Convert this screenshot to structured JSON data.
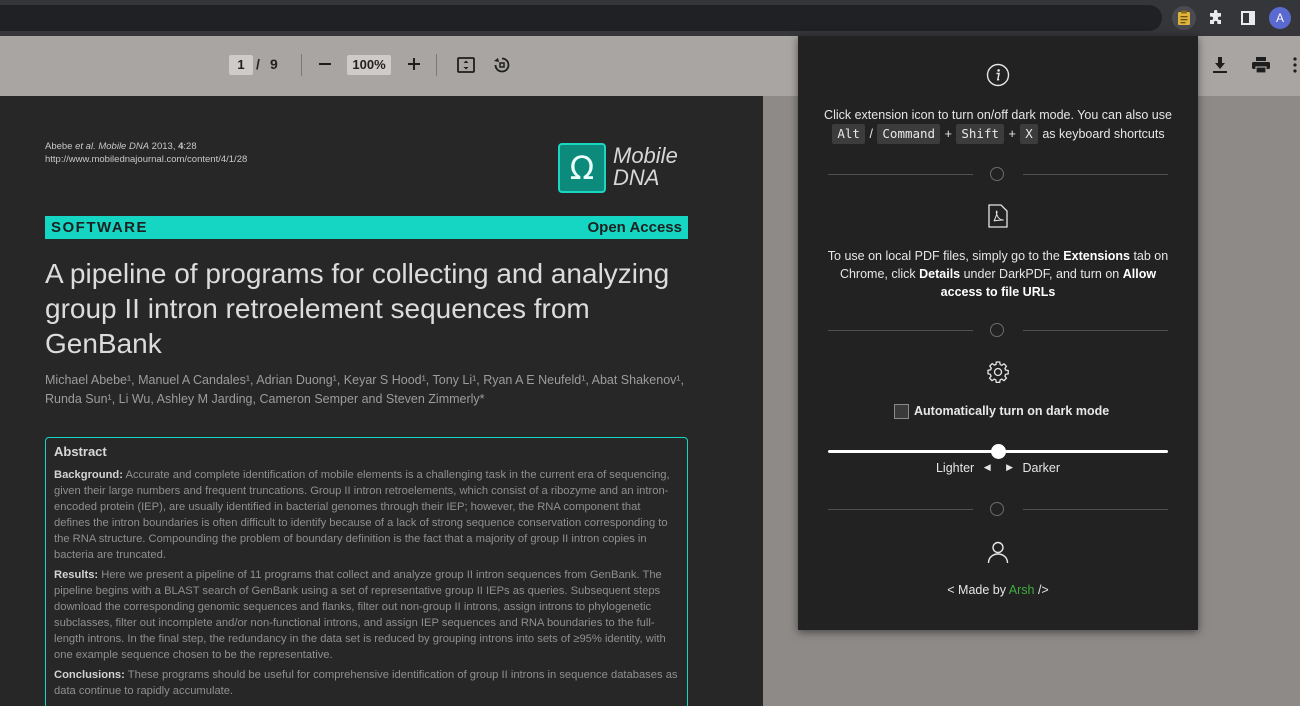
{
  "browser": {
    "extensions": [
      "darkpdf-extension-icon",
      "puzzle-icon",
      "side-panel-icon"
    ],
    "profile_initial": "A"
  },
  "toolbar": {
    "current_page": "1",
    "page_separator": "/",
    "total_pages": "9",
    "zoom": "100%"
  },
  "paper": {
    "citation_line1_authors": "Abebe ",
    "citation_line1_etal": "et al. Mobile DNA",
    "citation_line1_year": " 2013, ",
    "citation_line1_volume": "4",
    "citation_line1_page": ":28",
    "citation_url": "http://www.mobilednajournal.com/content/4/1/28",
    "logo_symbol": "Ω",
    "logo_line1": "Mobile",
    "logo_line2": "DNA",
    "category": "SOFTWARE",
    "access": "Open Access",
    "title": "A pipeline of programs for collecting and analyzing group II intron retroelement sequences from GenBank",
    "authors": "Michael Abebe¹, Manuel A Candales¹, Adrian Duong¹, Keyar S Hood¹, Tony Li¹, Ryan A E Neufeld¹, Abat Shakenov¹, Runda Sun¹, Li Wu, Ashley M Jarding, Cameron Semper and Steven Zimmerly*",
    "abstract_heading": "Abstract",
    "background_label": "Background:",
    "background_text": " Accurate and complete identification of mobile elements is a challenging task in the current era of sequencing, given their large numbers and frequent truncations. Group II intron retroelements, which consist of a ribozyme and an intron-encoded protein (IEP), are usually identified in bacterial genomes through their IEP; however, the RNA component that defines the intron boundaries is often difficult to identify because of a lack of strong sequence conservation corresponding to the RNA structure. Compounding the problem of boundary definition is the fact that a majority of group II intron copies in bacteria are truncated.",
    "results_label": "Results:",
    "results_text": " Here we present a pipeline of 11 programs that collect and analyze group II intron sequences from GenBank. The pipeline begins with a BLAST search of GenBank using a set of representative group II IEPs as queries. Subsequent steps download the corresponding genomic sequences and flanks, filter out non-group II introns, assign introns to phylogenetic subclasses, filter out incomplete and/or non-functional introns, and assign IEP sequences and RNA boundaries to the full-length introns. In the final step, the redundancy in the data set is reduced by grouping introns into sets of ≥95% identity, with one example sequence chosen to be the representative.",
    "conclusions_label": "Conclusions:",
    "conclusions_text": " These programs should be useful for comprehensive identification of group II introns in sequence databases as data continue to rapidly accumulate."
  },
  "popup": {
    "info_icon": "info-icon",
    "instruction_text": "Click extension icon to turn on/off dark mode. You can also use",
    "key_alt": "Alt",
    "key_slash": "/",
    "key_command": "Command",
    "key_plus1": "+",
    "key_shift": "Shift",
    "key_plus2": "+",
    "key_x": "X",
    "shortcut_suffix": "as keyboard shortcuts",
    "pdf_icon": "pdf-file-icon",
    "local_text_1": "To use on local PDF files, simply go to the ",
    "local_bold_1": "Extensions",
    "local_text_2": " tab on Chrome, click ",
    "local_bold_2": "Details",
    "local_text_3": " under DarkPDF, and turn on ",
    "local_bold_3": "Allow access to file URLs",
    "settings_icon": "gear-icon",
    "auto_dark_label": "Automatically turn on dark mode",
    "auto_dark_checked": false,
    "slider_fraction": 0.5,
    "lighter_label": "Lighter",
    "darker_label": "Darker",
    "user_icon": "user-icon",
    "credit_prefix": "< Made by ",
    "credit_name": "Arsh",
    "credit_suffix": " />",
    "credit_name_color": "#3fae3f"
  },
  "colors": {
    "accent_teal": "#14d6c3",
    "page_background": "#272727",
    "popup_background": "#222222"
  }
}
